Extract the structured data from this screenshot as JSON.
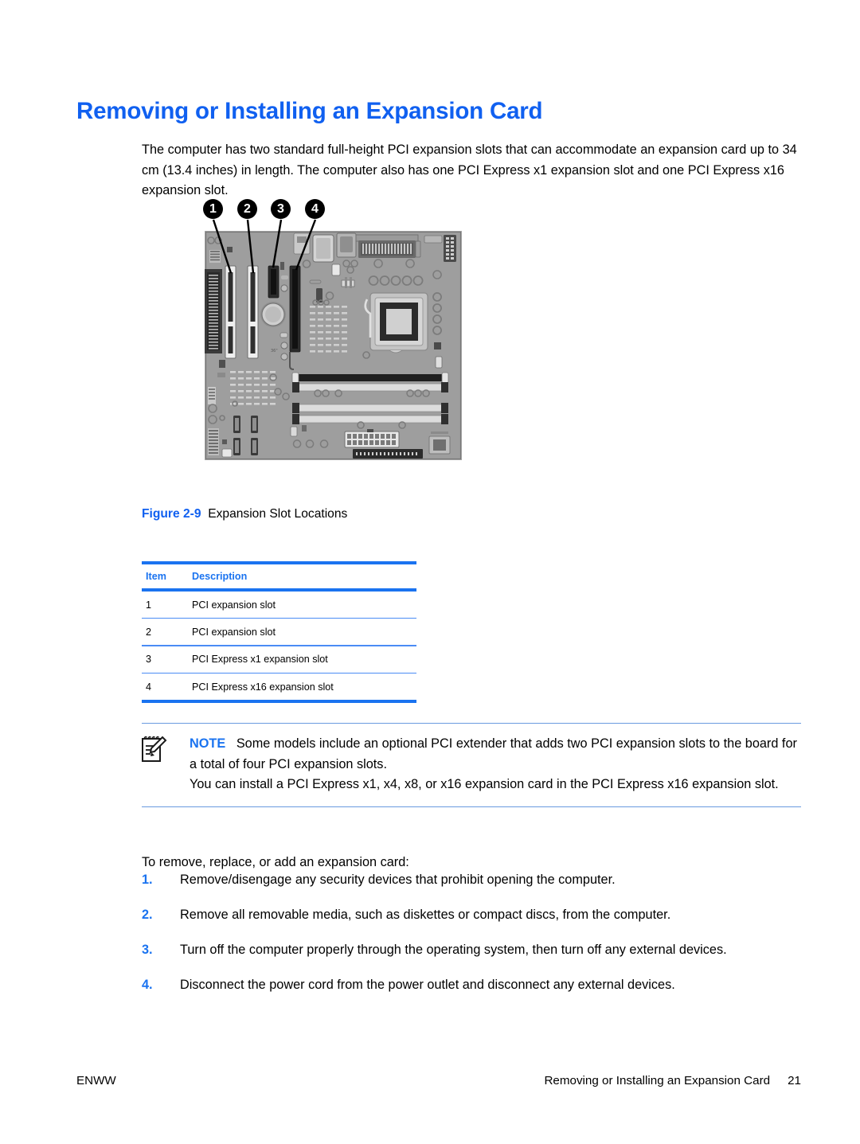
{
  "document": {
    "title": "Removing or Installing an Expansion Card",
    "intro": "The computer has two standard full-height PCI expansion slots that can accommodate an expansion card up to 34 cm (13.4 inches) in length. The computer also has one PCI Express x1 expansion slot and one PCI Express x16 expansion slot."
  },
  "figure": {
    "number_label": "Figure 2-9",
    "caption": "Expansion Slot Locations",
    "callouts": [
      {
        "id": "1",
        "label": "1"
      },
      {
        "id": "2",
        "label": "2"
      },
      {
        "id": "3",
        "label": "3"
      },
      {
        "id": "4",
        "label": "4"
      }
    ]
  },
  "table": {
    "headers": {
      "item": "Item",
      "description": "Description"
    },
    "rows": [
      {
        "item": "1",
        "description": "PCI expansion slot"
      },
      {
        "item": "2",
        "description": "PCI expansion slot"
      },
      {
        "item": "3",
        "description": "PCI Express x1 expansion slot"
      },
      {
        "item": "4",
        "description": "PCI Express x16 expansion slot"
      }
    ]
  },
  "note": {
    "label": "NOTE",
    "paragraph1": "Some models include an optional PCI extender that adds two PCI expansion slots to the board for a total of four PCI expansion slots.",
    "paragraph2": "You can install a PCI Express x1, x4, x8, or x16 expansion card in the PCI Express x16 expansion slot."
  },
  "procedure": {
    "lead_in": "To remove, replace, or add an expansion card:",
    "steps": [
      {
        "number": "1.",
        "text": "Remove/disengage any security devices that prohibit opening the computer."
      },
      {
        "number": "2.",
        "text": "Remove all removable media, such as diskettes or compact discs, from the computer."
      },
      {
        "number": "3.",
        "text": "Turn off the computer properly through the operating system, then turn off any external devices."
      },
      {
        "number": "4.",
        "text": "Disconnect the power cord from the power outlet and disconnect any external devices."
      }
    ]
  },
  "footer": {
    "left": "ENWW",
    "section": "Removing or Installing an Expansion Card",
    "page_number": "21"
  },
  "colors": {
    "accent_blue": "#1060F0",
    "table_rule": "#1A73F0",
    "note_rule": "#6A9BE0",
    "board_green": "#9E9E9E"
  }
}
